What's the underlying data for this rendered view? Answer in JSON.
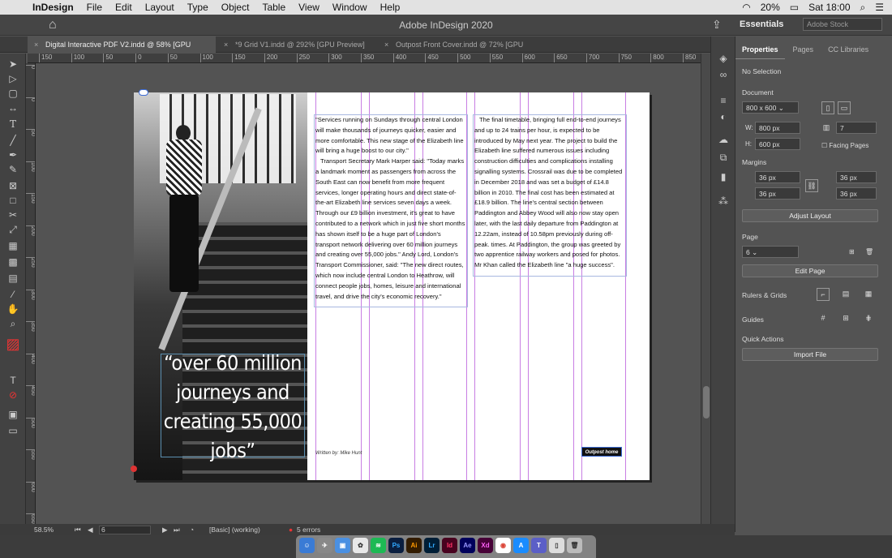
{
  "menubar": {
    "app": "InDesign",
    "items": [
      "File",
      "Edit",
      "Layout",
      "Type",
      "Object",
      "Table",
      "View",
      "Window",
      "Help"
    ],
    "battery": "20%",
    "clock": "Sat 18:00"
  },
  "titlebar": {
    "title": "Adobe InDesign 2020",
    "workspace": "Essentials",
    "stock_placeholder": "Adobe Stock"
  },
  "tabs": [
    {
      "label": "Digital Interactive PDF V2.indd @ 58% [GPU Preview]",
      "active": true
    },
    {
      "label": "*9 Grid V1.indd @ 292% [GPU Preview]",
      "active": false
    },
    {
      "label": "Outpost Front Cover.indd @ 72% [GPU Preview]",
      "active": false
    }
  ],
  "ruler": {
    "top": [
      "150",
      "100",
      "50",
      "0",
      "50",
      "100",
      "150",
      "200",
      "250",
      "300",
      "350",
      "400",
      "450",
      "500",
      "550",
      "600",
      "650",
      "700",
      "750",
      "800",
      "850"
    ],
    "left": [
      "0",
      "0",
      "5\n0",
      "1\n0\n0",
      "1\n5\n0",
      "2\n0\n0",
      "2\n5\n0",
      "3\n0\n0",
      "3\n5\n0",
      "4\n0\n0",
      "4\n5\n0",
      "5\n0\n0",
      "5\n5\n0",
      "6\n0\n0",
      "6\n5\n0"
    ]
  },
  "page": {
    "quote": "“over 60 million journeys and creating 55,000 jobs”",
    "col1": [
      "\"Services running on Sundays through central London will make thousands of journeys quicker, easier and more comfortable. This new stage of the Elizabeth line will bring a huge boost to our city.\"",
      "Transport Secretary Mark Harper said: \"Today marks a landmark moment as passengers from across the South East can now benefit from more frequent services, longer operating hours and direct state-of-the-art Elizabeth line services seven days a week. Through our £9 billion investment, it's great to have contributed to a network which in just five short months has shown itself to be a huge part of London's transport network delivering over 60 million journeys and creating over 55,000 jobs.\" Andy Lord, London's Transport Commissioner, said: \"The new direct routes, which now include central London to Heathrow, will connect people jobs, homes, leisure and international travel, and drive the city's economic recovery.\""
    ],
    "col2": [
      "The final timetable, bringing full end-to-end journeys and up to 24 trains per hour, is expected to be introduced by May next year. The project to build the Elizabeth line suffered numerous issues including construction difficulties and complications installing signalling systems. Crossrail was due to be completed in December 2018 and was set a budget of £14.8 billion in 2010. The final cost has been estimated at £18.9 billion. The line's central section between Paddington and Abbey Wood will also now stay open later, with the last daily departure from Paddington at 12.22am, instead of 10.58pm previously during off-peak. times. At Paddington, the group was greeted by two apprentice railway workers and posed for photos. Mr Khan called the Elizabeth line \"a huge success\"."
    ],
    "byline": "Written by: Mike Hunt",
    "button": "Outpost home"
  },
  "panel": {
    "tabs": [
      "Properties",
      "Pages",
      "CC Libraries"
    ],
    "selection": "No Selection",
    "document_label": "Document",
    "doc_size": "800 x 600",
    "w_label": "W:",
    "w_value": "800 px",
    "h_label": "H:",
    "h_value": "600 px",
    "pages_value": "7",
    "facing_pages": "Facing Pages",
    "margins_label": "Margins",
    "margin_top": "36 px",
    "margin_bottom": "36 px",
    "margin_left": "36 px",
    "margin_right": "36 px",
    "adjust_layout": "Adjust Layout",
    "page_label": "Page",
    "page_value": "6",
    "edit_page": "Edit Page",
    "rulers_grids": "Rulers & Grids",
    "guides": "Guides",
    "quick_actions": "Quick Actions",
    "import_file": "Import File"
  },
  "status": {
    "zoom": "58.5%",
    "page": "6",
    "style": "[Basic] (working)",
    "errors": "5 errors"
  },
  "dock": [
    "Ps",
    "Ai",
    "Lr",
    "Id",
    "Ae",
    "Xd"
  ]
}
